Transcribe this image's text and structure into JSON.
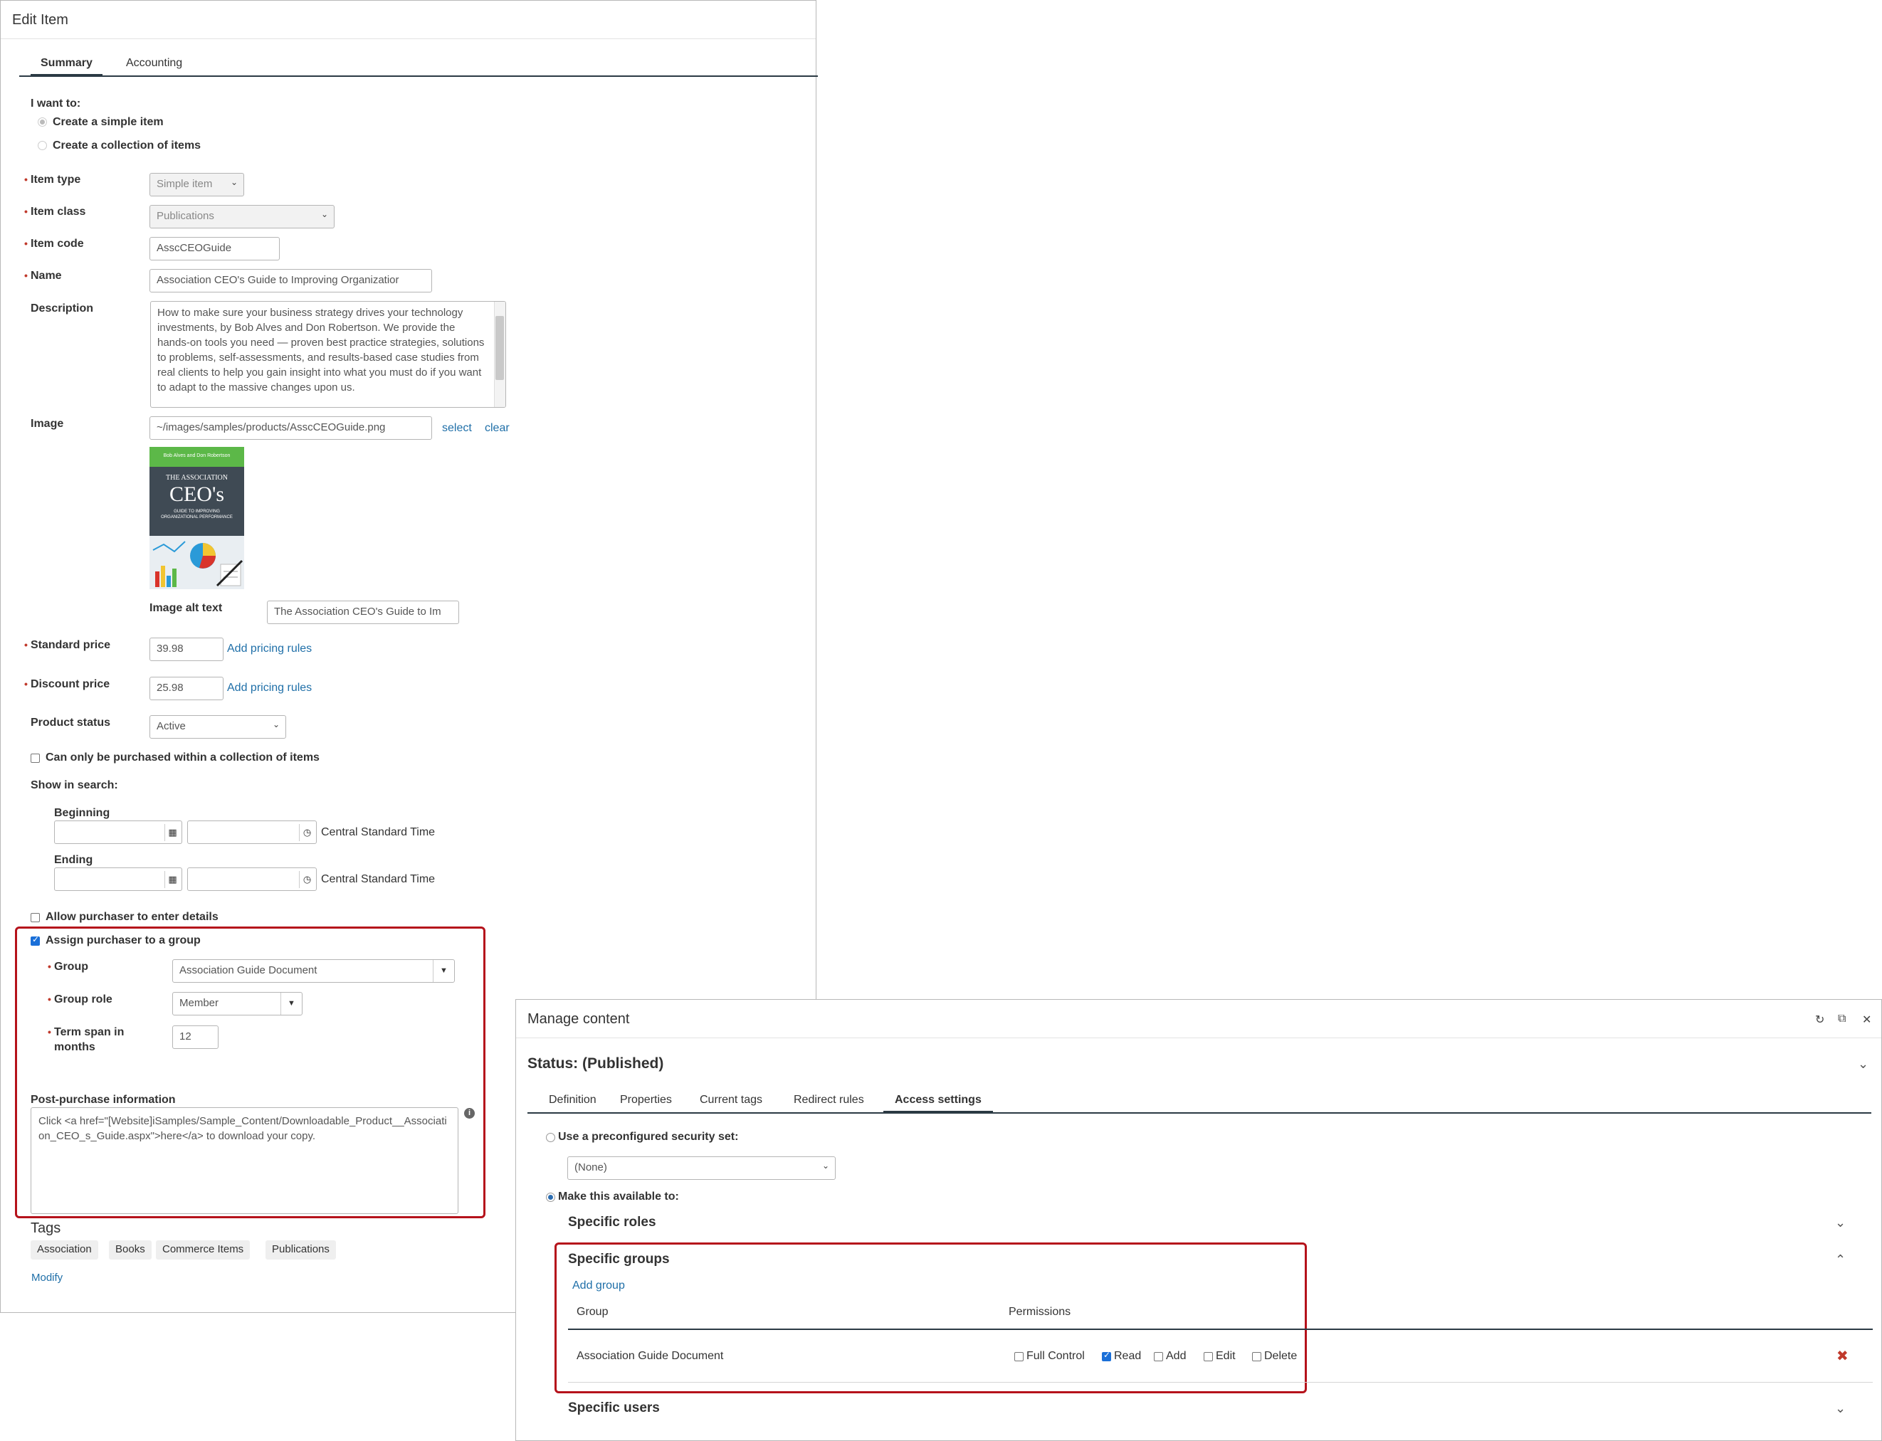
{
  "edit_item": {
    "title": "Edit Item",
    "tabs": [
      "Summary",
      "Accounting"
    ],
    "want_to_label": "I want to:",
    "options": {
      "simple": "Create a simple item",
      "collection": "Create a collection of items"
    },
    "item_type": {
      "label": "Item type",
      "value": "Simple item"
    },
    "item_class": {
      "label": "Item class",
      "value": "Publications"
    },
    "item_code": {
      "label": "Item code",
      "value": "AsscCEOGuide"
    },
    "name": {
      "label": "Name",
      "value": "Association CEO's Guide to Improving Organizatior"
    },
    "description": {
      "label": "Description",
      "value": "How to make sure your business strategy drives your technology investments, by Bob Alves and Don Robertson. We provide the hands-on tools you need — proven best practice strategies, solutions to problems, self-assessments, and results-based case studies from real clients to help you gain insight into what you must do if you want to adapt to the massive changes upon us."
    },
    "image": {
      "label": "Image",
      "path": "~/images/samples/products/AsscCEOGuide.png",
      "select": "select",
      "clear": "clear",
      "cover": {
        "authors": "Bob Alves and Don Robertson",
        "line1": "THE ASSOCIATION",
        "line2": "CEO's",
        "line3": "GUIDE TO IMPROVING",
        "line4": "ORGANIZATIONAL PERFORMANCE"
      },
      "alt_label": "Image alt text",
      "alt_value": "The Association CEO's Guide to Im"
    },
    "standard_price": {
      "label": "Standard price",
      "value": "39.98",
      "link": "Add pricing rules"
    },
    "discount_price": {
      "label": "Discount price",
      "value": "25.98",
      "link": "Add pricing rules"
    },
    "product_status": {
      "label": "Product status",
      "value": "Active"
    },
    "collection_only": "Can only be purchased within a collection of items",
    "show_in_search": "Show in search:",
    "beginning": "Beginning",
    "ending": "Ending",
    "timezone": "Central Standard Time",
    "allow_details": "Allow purchaser to enter details",
    "assign_group": "Assign purchaser to a group",
    "group": {
      "label": "Group",
      "value": "Association Guide Document"
    },
    "group_role": {
      "label": "Group role",
      "value": "Member"
    },
    "term_span": {
      "label_line1": "Term span in",
      "label_line2": "months",
      "value": "12"
    },
    "post_purchase": {
      "label": "Post-purchase information",
      "value": "Click <a href=\"[Website]iSamples/Sample_Content/Downloadable_Product__Association_CEO_s_Guide.aspx\">here</a> to download your copy."
    },
    "tags_title": "Tags",
    "tags": [
      "Association",
      "Books",
      "Commerce Items",
      "Publications"
    ],
    "modify": "Modify"
  },
  "manage_content": {
    "title": "Manage content",
    "status": "Status: (Published)",
    "tabs": [
      "Definition",
      "Properties",
      "Current tags",
      "Redirect rules",
      "Access settings"
    ],
    "preconfigured": "Use a preconfigured security set:",
    "preconfigured_value": "(None)",
    "make_available": "Make this available to:",
    "specific_roles": "Specific roles",
    "specific_groups": "Specific groups",
    "add_group": "Add group",
    "col_group": "Group",
    "col_permissions": "Permissions",
    "row_group": "Association Guide Document",
    "permissions": {
      "full": "Full Control",
      "read": "Read",
      "add": "Add",
      "edit": "Edit",
      "delete": "Delete"
    },
    "specific_users": "Specific users"
  }
}
